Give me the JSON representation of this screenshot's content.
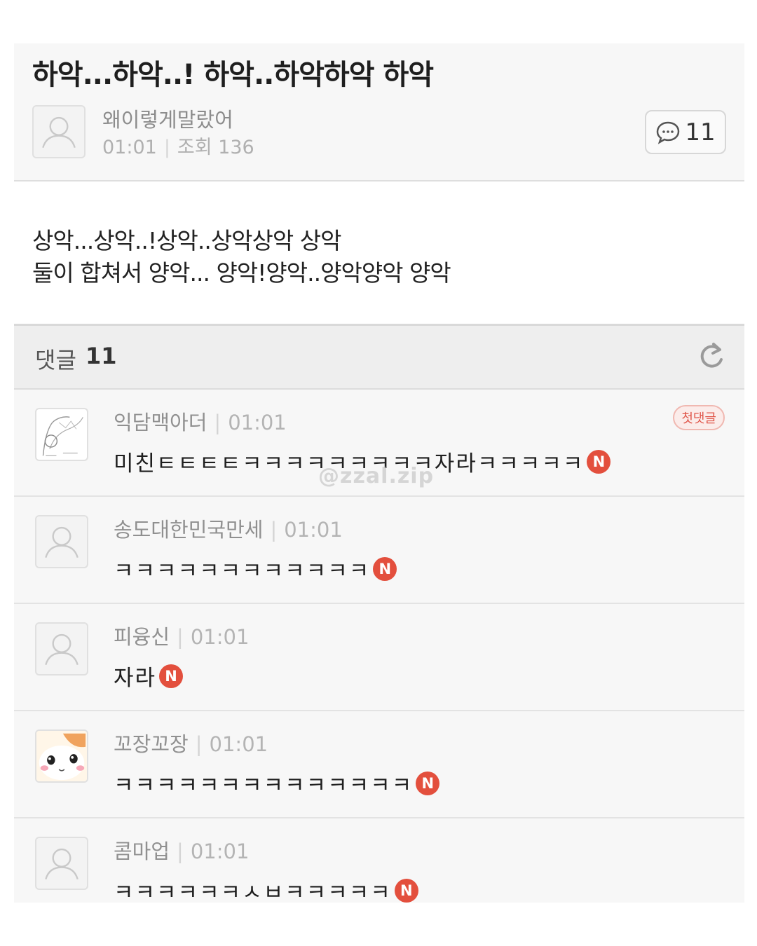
{
  "post": {
    "title": "하악...하악..! 하악..하악하악 하악",
    "author": "왜이렇게말랐어",
    "time": "01:01",
    "views": "조회 136",
    "comment_count": "11",
    "body": [
      "상악...상악..!상악..상악상악 상악",
      "둘이 합쳐서 양악... 양악!양악..양악양악 양악"
    ]
  },
  "comments_header": {
    "label": "댓글",
    "count": "11"
  },
  "comments": [
    {
      "name": "익담맥아더",
      "time": "01:01",
      "text": "미친ㅌㅌㅌㅌㅋㅋㅋㅋㅋㅋㅋㅋㅋ자라ㅋㅋㅋㅋㅋ",
      "badge": "N",
      "first": "첫댓글",
      "avatar": "sketch-avatar"
    },
    {
      "name": "송도대한민국만세",
      "time": "01:01",
      "text": "ㅋㅋㅋㅋㅋㅋㅋㅋㅋㅋㅋㅋ",
      "badge": "N",
      "avatar": "default-avatar"
    },
    {
      "name": "피융신",
      "time": "01:01",
      "text": "자라",
      "badge": "N",
      "avatar": "default-avatar"
    },
    {
      "name": "꼬장꼬장",
      "time": "01:01",
      "text": "ㅋㅋㅋㅋㅋㅋㅋㅋㅋㅋㅋㅋㅋㅋ",
      "badge": "N",
      "avatar": "hamster-avatar"
    },
    {
      "name": "콤마업",
      "time": "01:01",
      "text": "ㅋㅋㅋㅋㅋㅋㅅㅂㅋㅋㅋㅋㅋ",
      "badge": "N",
      "avatar": "default-avatar"
    }
  ],
  "watermark": "@zzal.zip",
  "icons": {
    "comment": "speech-bubble-icon",
    "refresh": "refresh-icon",
    "avatar": "person-silhouette-icon"
  },
  "colors": {
    "badge": "#e34f3d",
    "background": "#f7f7f7"
  }
}
